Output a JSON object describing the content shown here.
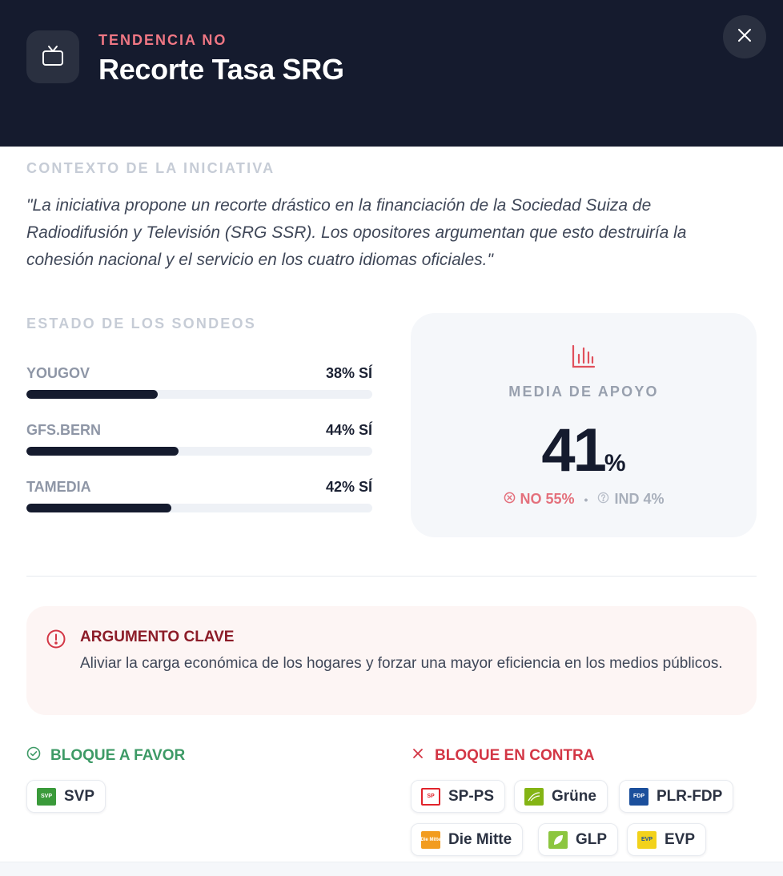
{
  "header": {
    "kicker": "TENDENCIA NO",
    "title": "Recorte Tasa SRG",
    "icon": "tv-icon",
    "close_icon": "close-icon"
  },
  "context": {
    "label": "CONTEXTO DE LA INICIATIVA",
    "text": "\"La iniciativa propone un recorte drástico en la financiación de la Sociedad Suiza de Radiodifusión y Televisión (SRG SSR). Los opositores argumentan que esto destruiría la cohesión nacional y el servicio en los cuatro idiomas oficiales.\""
  },
  "polls": {
    "label": "ESTADO DE LOS SONDEOS",
    "items": [
      {
        "name": "YOUGOV",
        "value_label": "38% SÍ",
        "value": 38
      },
      {
        "name": "GFS.BERN",
        "value_label": "44% SÍ",
        "value": 44
      },
      {
        "name": "TAMEDIA",
        "value_label": "42% SÍ",
        "value": 42
      }
    ]
  },
  "average": {
    "icon": "bar-chart-icon",
    "label": "MEDIA DE APOYO",
    "value": "41",
    "unit": "%",
    "no_label": "NO 55%",
    "ind_label": "IND 4%",
    "separator": "•"
  },
  "key_argument": {
    "icon": "alert-circle-icon",
    "title": "ARGUMENTO CLAVE",
    "text": "Aliviar la carga económica de los hogares y forzar una mayor eficiencia en los medios públicos."
  },
  "favor": {
    "icon": "check-circle-icon",
    "title": "BLOQUE A FAVOR",
    "parties": [
      {
        "name": "SVP",
        "logo_text": "SVP",
        "logo_color": "#3a9a3a"
      }
    ]
  },
  "contra": {
    "icon": "x-icon",
    "title": "BLOQUE EN CONTRA",
    "parties": [
      {
        "name": "SP-PS",
        "logo_text": "SP",
        "logo_color": "#e1232b"
      },
      {
        "name": "Grüne",
        "logo_text": "",
        "logo_color": "#84b414"
      },
      {
        "name": "PLR-FDP",
        "logo_text": "FDP",
        "logo_color": "#1b4f9c"
      },
      {
        "name": "Die Mitte",
        "logo_text": "Die Mitte",
        "logo_color": "#f29c1f"
      },
      {
        "name": "GLP",
        "logo_text": "",
        "logo_color": "#8cc63f"
      },
      {
        "name": "EVP",
        "logo_text": "EVP",
        "logo_color": "#f2d21b"
      }
    ]
  },
  "colors": {
    "header_bg": "#151b2e",
    "accent_no": "#f07784",
    "favor": "#3d9a66",
    "contra": "#d33645"
  }
}
